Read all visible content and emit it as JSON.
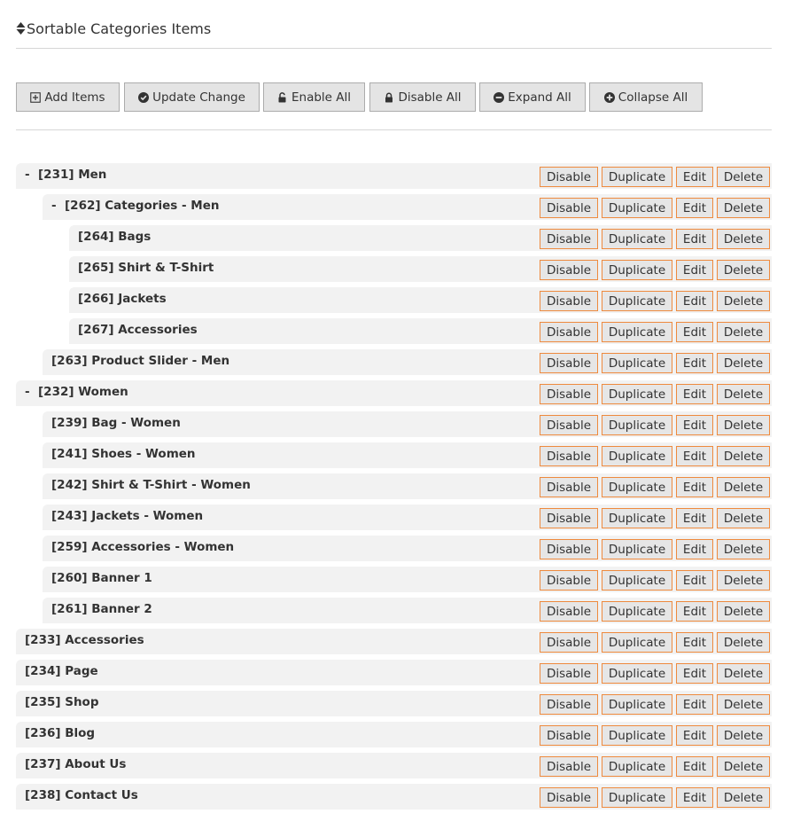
{
  "header": {
    "title": "Sortable Categories Items"
  },
  "toolbar": {
    "add_items": "Add Items",
    "update_change": "Update Change",
    "enable_all": "Enable All",
    "disable_all": "Disable All",
    "expand_all": "Expand All",
    "collapse_all": "Collapse All"
  },
  "actions": {
    "disable": "Disable",
    "duplicate": "Duplicate",
    "edit": "Edit",
    "delete": "Delete"
  },
  "tree_items": [
    {
      "label": "[231] Men",
      "level": 0,
      "toggle": "-"
    },
    {
      "label": "[262] Categories - Men",
      "level": 1,
      "toggle": "-"
    },
    {
      "label": "[264] Bags",
      "level": 2,
      "toggle": ""
    },
    {
      "label": "[265] Shirt & T-Shirt",
      "level": 2,
      "toggle": ""
    },
    {
      "label": "[266] Jackets",
      "level": 2,
      "toggle": ""
    },
    {
      "label": "[267] Accessories",
      "level": 2,
      "toggle": ""
    },
    {
      "label": "[263] Product Slider - Men",
      "level": 1,
      "toggle": ""
    },
    {
      "label": "[232] Women",
      "level": 0,
      "toggle": "-"
    },
    {
      "label": "[239] Bag - Women",
      "level": 1,
      "toggle": ""
    },
    {
      "label": "[241] Shoes - Women",
      "level": 1,
      "toggle": ""
    },
    {
      "label": "[242] Shirt & T-Shirt - Women",
      "level": 1,
      "toggle": ""
    },
    {
      "label": "[243] Jackets - Women",
      "level": 1,
      "toggle": ""
    },
    {
      "label": "[259] Accessories - Women",
      "level": 1,
      "toggle": ""
    },
    {
      "label": "[260] Banner 1",
      "level": 1,
      "toggle": ""
    },
    {
      "label": "[261] Banner 2",
      "level": 1,
      "toggle": ""
    },
    {
      "label": "[233] Accessories",
      "level": 0,
      "toggle": ""
    },
    {
      "label": "[234] Page",
      "level": 0,
      "toggle": ""
    },
    {
      "label": "[235] Shop",
      "level": 0,
      "toggle": ""
    },
    {
      "label": "[236] Blog",
      "level": 0,
      "toggle": ""
    },
    {
      "label": "[237] About Us",
      "level": 0,
      "toggle": ""
    },
    {
      "label": "[238] Contact Us",
      "level": 0,
      "toggle": ""
    }
  ],
  "icons": {
    "header": "sort-icon",
    "add_items": "plus-square-icon",
    "update_change": "check-circle-icon",
    "enable_all": "unlock-icon",
    "disable_all": "lock-icon",
    "expand_all": "minus-circle-icon",
    "collapse_all": "plus-circle-icon"
  },
  "colors": {
    "action_border": "#ee8a3e",
    "row_background": "#f2f2f2",
    "toolbar_button_background": "#e4e4e4"
  }
}
